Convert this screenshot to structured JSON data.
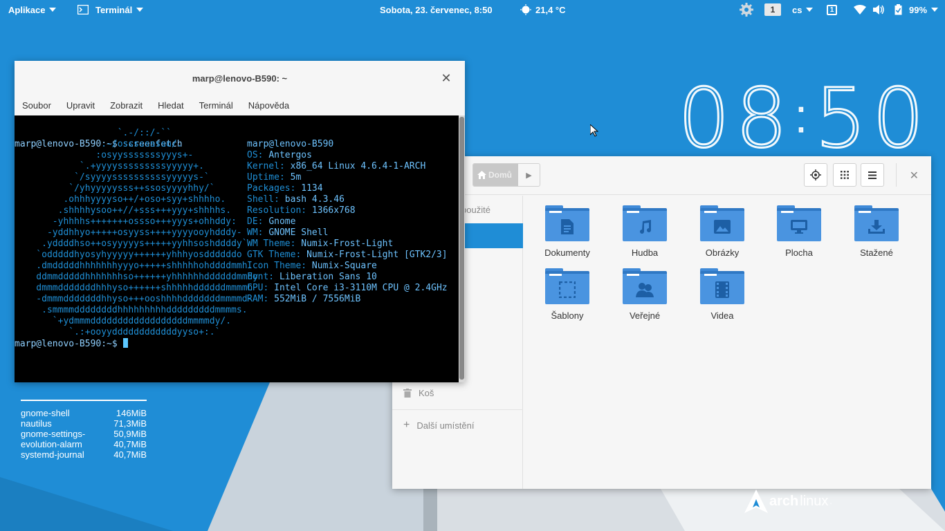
{
  "topbar": {
    "apps_label": "Aplikace",
    "terminal_label": "Terminál",
    "datetime": "Sobota, 23. červenec,  8:50",
    "weather": "21,4 °C",
    "workspace": "1",
    "language": "cs",
    "notifications_count": "1",
    "battery": "99%"
  },
  "clock": {
    "hour": "08",
    "sep": ":",
    "minute": "50"
  },
  "terminal": {
    "title": "marp@lenovo-B590: ~",
    "menu": [
      "Soubor",
      "Upravit",
      "Zobrazit",
      "Hledat",
      "Terminál",
      "Nápověda"
    ],
    "prompt1": "marp@lenovo-B590:~$ screenfetch",
    "prompt2": "marp@lenovo-B590:~$ ",
    "logo_lines": [
      "                   `.-/::/-``",
      "                .-/osssssssso/.",
      "               :osyysssssssyyys+-",
      "            `.+yyyysssssssssyyyyy+.",
      "           `/syyyyssssssssssyyyyys-`",
      "          `/yhyyyyysss++ssosyyyyhhy/`",
      "         .ohhhyyyyso++/+oso+syy+shhhho.",
      "        .shhhhysoo++//+sss+++yyy+shhhhs.",
      "       -yhhhhs+++++++ossso+++yyys+ohhddy:",
      "      -yddhhyo+++++osyyss++++yyyyooyhdddy-",
      "     .yddddhso++osyyyyys+++++yyhhsoshddddy`",
      "    `odddddhyosyhyyyyy++++++yhhhyosddddddo",
      "    .dmdddddhhhhhhhyyyo+++++shhhhhohddddmmh.",
      "    ddmmdddddhhhhhhhso++++++yhhhhhhddddddmmdy",
      "    dmmmdddddddhhhyso++++++shhhhhddddddmmmmh",
      "    -dmmmdddddddhhyso+++ooshhhhdddddddmmmmd-",
      "     .smmmmddddddddhhhhhhhhhdddddddddmmmms.",
      "       `+ydmmmddddddddddddddddddmmmmdy/.",
      "          `.:+ooyyddddddddddddyyso+:.`"
    ],
    "info": [
      {
        "k": "",
        "v": "marp@lenovo-B590"
      },
      {
        "k": "OS: ",
        "v": "Antergos"
      },
      {
        "k": "Kernel: ",
        "v": "x86_64 Linux 4.6.4-1-ARCH"
      },
      {
        "k": "Uptime: ",
        "v": "5m"
      },
      {
        "k": "Packages: ",
        "v": "1134"
      },
      {
        "k": "Shell: ",
        "v": "bash 4.3.46"
      },
      {
        "k": "Resolution: ",
        "v": "1366x768"
      },
      {
        "k": "DE: ",
        "v": "Gnome"
      },
      {
        "k": "WM: ",
        "v": "GNOME Shell"
      },
      {
        "k": "WM Theme: ",
        "v": "Numix-Frost-Light"
      },
      {
        "k": "GTK Theme: ",
        "v": "Numix-Frost-Light [GTK2/3]"
      },
      {
        "k": "Icon Theme: ",
        "v": "Numix-Square"
      },
      {
        "k": "Font: ",
        "v": "Liberation Sans 10"
      },
      {
        "k": "CPU: ",
        "v": "Intel Core i3-3110M CPU @ 2.4GHz"
      },
      {
        "k": "RAM: ",
        "v": "552MiB / 7556MiB"
      }
    ]
  },
  "files": {
    "path_home": "Domů",
    "sidebar": {
      "recent": "použité",
      "trash": "Koš",
      "other": "Další umístění"
    },
    "folders": [
      {
        "label": "Dokumenty",
        "glyph": "document-icon"
      },
      {
        "label": "Hudba",
        "glyph": "music-icon"
      },
      {
        "label": "Obrázky",
        "glyph": "picture-icon"
      },
      {
        "label": "Plocha",
        "glyph": "desktop-icon"
      },
      {
        "label": "Stažené",
        "glyph": "download-icon"
      },
      {
        "label": "Šablony",
        "glyph": "template-icon"
      },
      {
        "label": "Veřejné",
        "glyph": "people-icon"
      },
      {
        "label": "Videa",
        "glyph": "video-icon"
      }
    ]
  },
  "processes": [
    {
      "name": "gnome-shell",
      "mem": "146MiB"
    },
    {
      "name": "nautilus",
      "mem": "71,3MiB"
    },
    {
      "name": "gnome-settings-",
      "mem": "50,9MiB"
    },
    {
      "name": "evolution-alarm",
      "mem": "40,7MiB"
    },
    {
      "name": "systemd-journal",
      "mem": "40,7MiB"
    }
  ],
  "branding": {
    "arch_a": "arch",
    "arch_b": "linux",
    "arch_suffix": "."
  },
  "colors": {
    "desktop": "#1f8dd6",
    "folder": "#4a94e0",
    "terminal_text": "#6ec3ff"
  }
}
